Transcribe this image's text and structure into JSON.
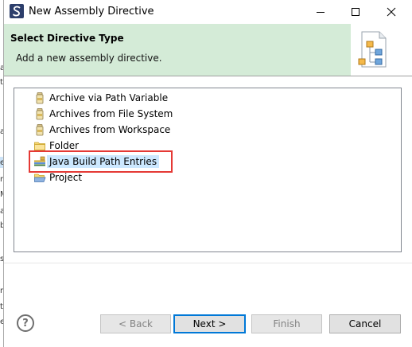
{
  "window": {
    "title": "New Assembly Directive",
    "minimize_icon": "minimize-icon",
    "maximize_icon": "maximize-icon",
    "close_icon": "close-icon"
  },
  "banner": {
    "title": "Select Directive Type",
    "description": "Add a new assembly directive.",
    "image_icon": "assembly-wizard-icon"
  },
  "tree": {
    "items": [
      {
        "label": "Archive via Path Variable",
        "icon": "jar-icon",
        "selected": false
      },
      {
        "label": "Archives from File System",
        "icon": "jar-icon",
        "selected": false
      },
      {
        "label": "Archives from Workspace",
        "icon": "jar-icon",
        "selected": false
      },
      {
        "label": "Folder",
        "icon": "folder-icon",
        "selected": false
      },
      {
        "label": "Java Build Path Entries",
        "icon": "library-icon",
        "selected": true
      },
      {
        "label": "Project",
        "icon": "project-folder-icon",
        "selected": false
      }
    ]
  },
  "buttons": {
    "help": "?",
    "back": "< Back",
    "next": "Next >",
    "finish": "Finish",
    "cancel": "Cancel"
  },
  "background_chars": [
    "a",
    "ty",
    "a",
    "e",
    "m",
    "M",
    "a",
    "b",
    "s",
    "n",
    "t",
    "e"
  ],
  "colors": {
    "banner_bg": "#d4ebd7",
    "highlight_border": "#e53935",
    "selection_bg": "#cce8ff",
    "default_button_border": "#0078d7"
  }
}
